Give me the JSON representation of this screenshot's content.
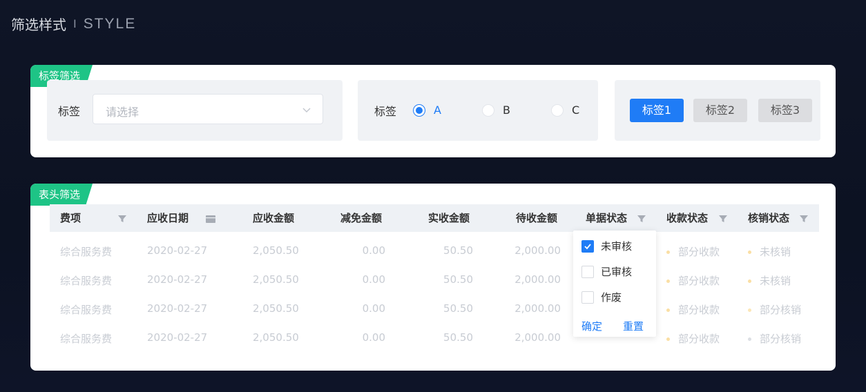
{
  "page": {
    "title_cn": "筛选样式",
    "separator": "I",
    "title_en": "STYLE"
  },
  "card1": {
    "ribbon": "标签筛选",
    "select_group": {
      "label": "标签",
      "placeholder": "请选择"
    },
    "radio_group": {
      "label": "标签",
      "options": [
        {
          "label": "A",
          "selected": true
        },
        {
          "label": "B",
          "selected": false
        },
        {
          "label": "C",
          "selected": false
        }
      ]
    },
    "tag_buttons": [
      {
        "label": "标签1",
        "active": true
      },
      {
        "label": "标签2",
        "active": false
      },
      {
        "label": "标签3",
        "active": false
      }
    ]
  },
  "card2": {
    "ribbon": "表头筛选",
    "columns": [
      "费项",
      "应收日期",
      "应收金额",
      "减免金额",
      "实收金额",
      "待收金额",
      "单据状态",
      "收款状态",
      "核销状态"
    ],
    "rows": [
      {
        "item": "综合服务费",
        "date": "2020-02-27",
        "receivable": "2,050.50",
        "discount": "0.00",
        "received": "50.50",
        "pending": "2,000.00",
        "collect_status": "部分收款",
        "verify_status": "未核销"
      },
      {
        "item": "综合服务费",
        "date": "2020-02-27",
        "receivable": "2,050.50",
        "discount": "0.00",
        "received": "50.50",
        "pending": "2,000.00",
        "collect_status": "部分收款",
        "verify_status": "未核销"
      },
      {
        "item": "综合服务费",
        "date": "2020-02-27",
        "receivable": "2,050.50",
        "discount": "0.00",
        "received": "50.50",
        "pending": "2,000.00",
        "collect_status": "部分收款",
        "verify_status": "部分核销"
      },
      {
        "item": "综合服务费",
        "date": "2020-02-27",
        "receivable": "2,050.50",
        "discount": "0.00",
        "received": "50.50",
        "pending": "2,000.00",
        "collect_status": "部分收款",
        "verify_status": "部分核销"
      }
    ],
    "filter_dropdown": {
      "options": [
        {
          "label": "未审核",
          "checked": true
        },
        {
          "label": "已审核",
          "checked": false
        },
        {
          "label": "作废",
          "checked": false
        }
      ],
      "confirm": "确定",
      "reset": "重置"
    }
  },
  "colors": {
    "accent": "#1f7cf6",
    "ribbon": "#1ec486",
    "status_dot": "#f5c04a"
  },
  "icons": [
    "chevron-down-icon",
    "filter-icon",
    "calendar-icon",
    "check-icon"
  ]
}
